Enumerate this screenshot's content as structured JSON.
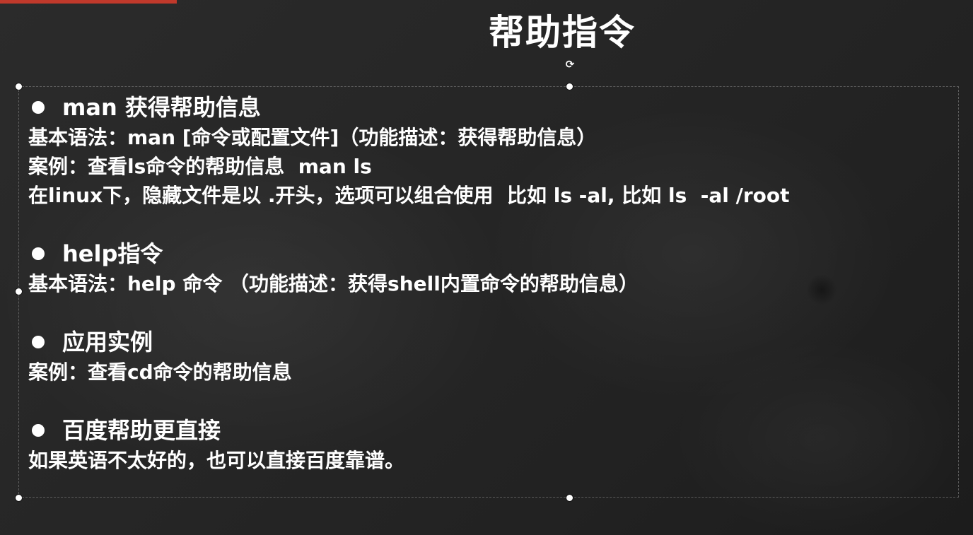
{
  "slide": {
    "title": "帮助指令",
    "rotate_glyph": "⟳",
    "sections": [
      {
        "heading": "man 获得帮助信息",
        "lines": [
          "基本语法：man [命令或配置文件]（功能描述：获得帮助信息）",
          "案例：查看ls命令的帮助信息  man ls",
          "在linux下，隐藏文件是以 .开头，选项可以组合使用  比如 ls -al, 比如 ls  -al /root"
        ]
      },
      {
        "heading": "help指令",
        "lines": [
          "基本语法：help 命令 （功能描述：获得shell内置命令的帮助信息）"
        ]
      },
      {
        "heading": "应用实例",
        "lines": [
          "案例：查看cd命令的帮助信息"
        ]
      },
      {
        "heading": "百度帮助更直接",
        "lines": [
          "如果英语不太好的，也可以直接百度靠谱。"
        ]
      }
    ]
  },
  "colors": {
    "background": "#262626",
    "text": "#ffffff",
    "accent": "#c0392b"
  },
  "icons": {
    "bullet": "filled-circle-bullet",
    "rotate": "rotate-handle-icon"
  }
}
